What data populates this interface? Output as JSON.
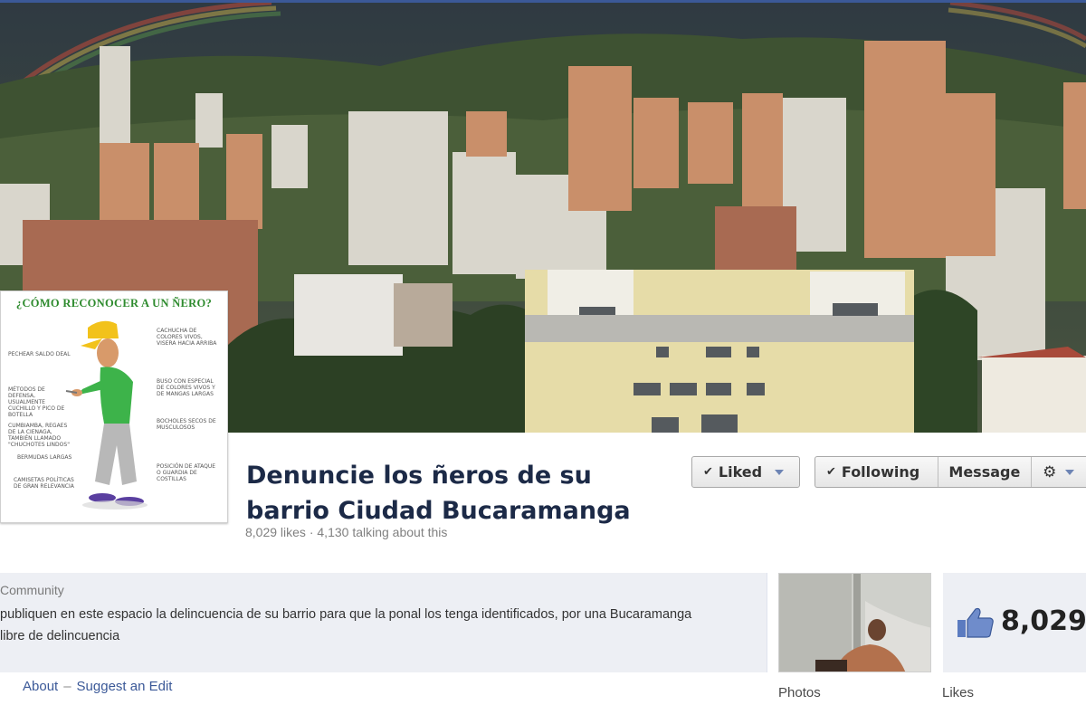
{
  "page": {
    "title": "Denuncie los ñeros de su barrio Ciudad Bucaramanga",
    "likes_text": "8,029 likes",
    "talking_text": "4,130 talking about this",
    "separator": "·"
  },
  "buttons": {
    "liked": "Liked",
    "following": "Following",
    "message": "Message"
  },
  "profile_picture": {
    "heading": "¿CÓMO RECONOCER A UN ÑERO?",
    "notes_left": [
      "PECHEAR SALDO DEAL",
      "MÉTODOS DE DEFENSA, USUALMENTE CUCHILLO Y PICO DE BOTELLA",
      "CUMBIAMBA, REGAES DE LA CIENAGA, TAMBIÉN LLAMADO \"CHUCHOTES LINDOS\"",
      "BERMUDAS LARGAS",
      "CAMISETAS POLÍTICAS DE GRAN RELEVANCIA"
    ],
    "notes_right": [
      "CACHUCHA DE COLORES VIVOS, VISERA HACIA ARRIBA",
      "BUSO CON ESPECIAL DE COLORES VIVOS Y DE MANGAS LARGAS",
      "BOCHOLES SECOS DE MUSCULOSOS",
      "POSICIÓN DE ATAQUE O GUARDIA DE COSTILLAS"
    ]
  },
  "about": {
    "category": "Community",
    "description": "publiquen en este espacio la delincuencia de su barrio para que la ponal los tenga identificados, por una Bucaramanga libre de delincuencia",
    "about_link": "About",
    "dash": "–",
    "edit_link": "Suggest an Edit"
  },
  "tiles": {
    "photos_label": "Photos",
    "likes_label": "Likes",
    "likes_count": "8,029"
  },
  "colors": {
    "brand": "#3b5998",
    "title": "#1c2a47",
    "panel": "#edeff4"
  }
}
